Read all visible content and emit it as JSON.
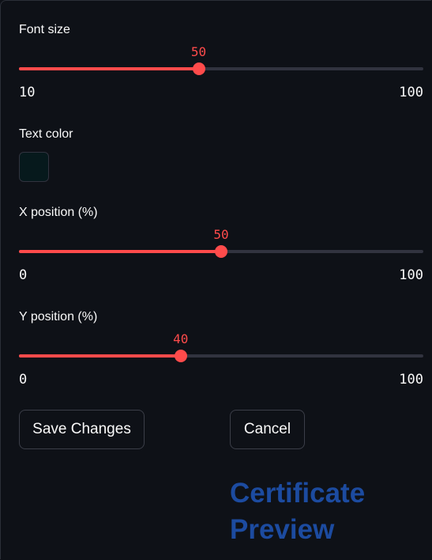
{
  "font_size": {
    "label": "Font size",
    "value": "50",
    "min": "10",
    "max": "100",
    "fraction": 0.4444
  },
  "text_color": {
    "label": "Text color",
    "color": "#06191c"
  },
  "x_position": {
    "label": "X position (%)",
    "value": "50",
    "min": "0",
    "max": "100",
    "fraction": 0.5
  },
  "y_position": {
    "label": "Y position (%)",
    "value": "40",
    "min": "0",
    "max": "100",
    "fraction": 0.4
  },
  "buttons": {
    "save_label": "Save Changes",
    "cancel_label": "Cancel"
  },
  "preview": {
    "line1": "Certificate",
    "line2": "Preview",
    "color": "#1c4ba0"
  },
  "accent_color": "#ff4b4b"
}
